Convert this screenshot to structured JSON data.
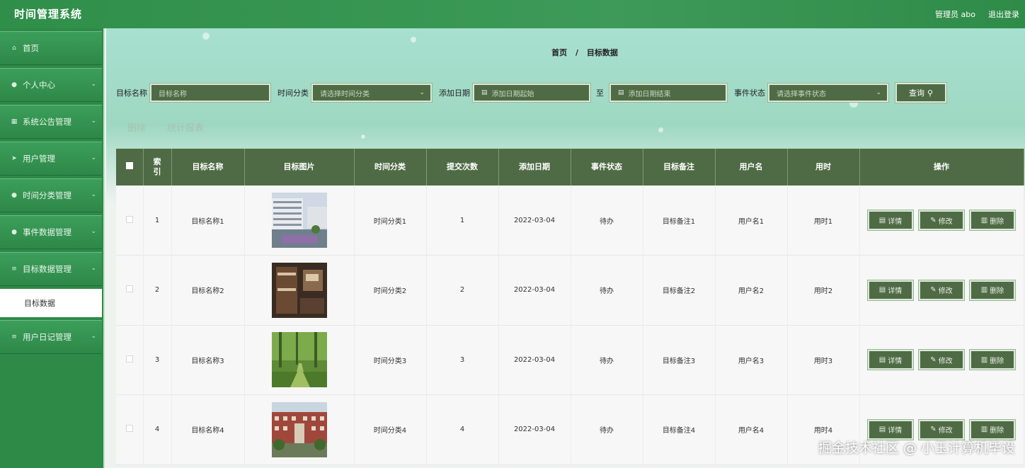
{
  "header": {
    "title": "时间管理系统",
    "user": "管理员 abo",
    "logout": "退出登录"
  },
  "sidebar": {
    "items": [
      {
        "label": "首页",
        "icon": "home-icon",
        "glyph": "⌂",
        "chevron": false
      },
      {
        "label": "个人中心",
        "icon": "user-icon",
        "glyph": "●",
        "chevron": true
      },
      {
        "label": "系统公告管理",
        "icon": "grid-icon",
        "glyph": "▦",
        "chevron": true
      },
      {
        "label": "用户管理",
        "icon": "send-icon",
        "glyph": "➤",
        "chevron": true
      },
      {
        "label": "时间分类管理",
        "icon": "pin-icon",
        "glyph": "●",
        "chevron": true
      },
      {
        "label": "事件数据管理",
        "icon": "user-icon",
        "glyph": "●",
        "chevron": true
      },
      {
        "label": "目标数据管理",
        "icon": "list-icon",
        "glyph": "≡",
        "chevron": true
      }
    ],
    "submenu": "目标数据",
    "last_item": {
      "label": "用户日记管理",
      "icon": "list-icon",
      "glyph": "≡"
    }
  },
  "breadcrumb": {
    "home": "首页",
    "sep": "/",
    "current": "目标数据"
  },
  "filters": {
    "name_label": "目标名称",
    "name_placeholder": "目标名称",
    "category_label": "时间分类",
    "category_placeholder": "请选择时间分类",
    "date_label": "添加日期",
    "date_start": "添加日期起始",
    "to": "至",
    "date_end": "添加日期结束",
    "status_label": "事件状态",
    "status_placeholder": "请选择事件状态",
    "query": "查询"
  },
  "actions": {
    "delete": "删除",
    "report": "统计报表"
  },
  "table": {
    "columns": [
      "索引",
      "目标名称",
      "目标图片",
      "时间分类",
      "提交次数",
      "添加日期",
      "事件状态",
      "目标备注",
      "用户名",
      "用时",
      "操作"
    ],
    "rows": [
      [
        "1",
        "目标名称1",
        "时间分类1",
        "1",
        "2022-03-04",
        "待办",
        "目标备注1",
        "用户名1",
        "用时1"
      ],
      [
        "2",
        "目标名称2",
        "时间分类2",
        "2",
        "2022-03-04",
        "待办",
        "目标备注2",
        "用户名2",
        "用时2"
      ],
      [
        "3",
        "目标名称3",
        "时间分类3",
        "3",
        "2022-03-04",
        "待办",
        "目标备注3",
        "用户名3",
        "用时3"
      ],
      [
        "4",
        "目标名称4",
        "时间分类4",
        "4",
        "2022-03-04",
        "待办",
        "目标备注4",
        "用户名4",
        "用时4"
      ]
    ],
    "ops": {
      "detail": "详情",
      "edit": "修改",
      "delete": "删除"
    }
  },
  "watermark": "掘金技术社区 @ 小玉计算机毕设",
  "colors": {
    "primary": "#2f8f4a",
    "dark_button": "#4f6b45",
    "header_row": "#4f6b45"
  }
}
